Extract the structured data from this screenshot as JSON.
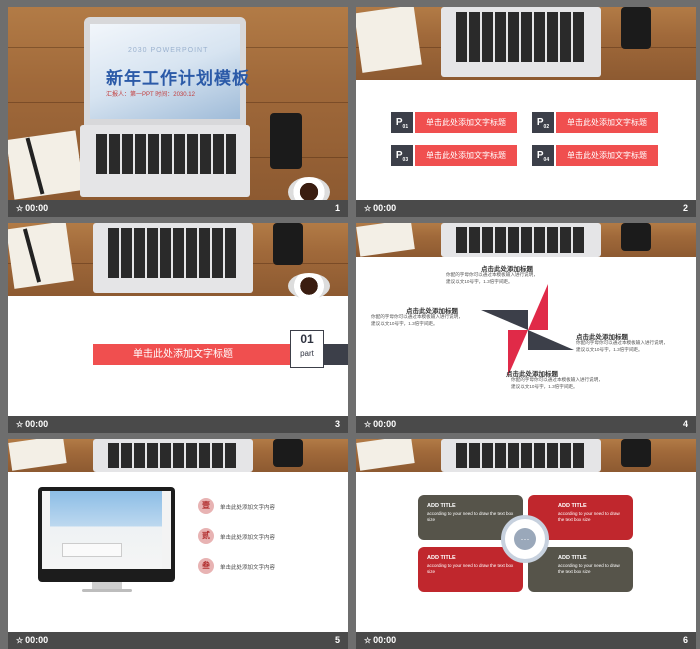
{
  "slides": [
    {
      "number": "1",
      "time": "00:00",
      "subtitle": "2030 POWERPOINT",
      "title": "新年工作计划模板",
      "info": "汇报人：第一PPT  时间：2030.12"
    },
    {
      "number": "2",
      "time": "00:00",
      "items": [
        {
          "icon": "P",
          "sub": "01",
          "label": "单击此处添加文字标题"
        },
        {
          "icon": "P",
          "sub": "02",
          "label": "单击此处添加文字标题"
        },
        {
          "icon": "P",
          "sub": "03",
          "label": "单击此处添加文字标题"
        },
        {
          "icon": "P",
          "sub": "04",
          "label": "单击此处添加文字标题"
        }
      ]
    },
    {
      "number": "3",
      "time": "00:00",
      "banner": "单击此处添加文字标题",
      "part_number": "01",
      "part_label": "part"
    },
    {
      "number": "4",
      "time": "00:00",
      "blocks": [
        {
          "title": "点击此处添加标题",
          "text": "你配的字母你可以通过本模板输入进行说明，建议以文10号字，1.3倍字间距。"
        },
        {
          "title": "点击此处添加标题",
          "text": "你配的字母你可以通过本模板输入进行说明，建议以文10号字，1.3倍字间距。"
        },
        {
          "title": "点击此处添加标题",
          "text": "你配的字母你可以通过本模板输入进行说明，建议以文10号字，1.3倍字间距。"
        },
        {
          "title": "点击此处添加标题",
          "text": "你配的字母你可以通过本模板输入进行说明，建议以文10号字，1.3倍字间距。"
        }
      ]
    },
    {
      "number": "5",
      "time": "00:00",
      "items": [
        {
          "icon": "壹",
          "text": "单击此处添加文字内容"
        },
        {
          "icon": "贰",
          "text": "单击此处添加文字内容"
        },
        {
          "icon": "叁",
          "text": "单击此处添加文字内容"
        }
      ]
    },
    {
      "number": "6",
      "time": "00:00",
      "boxes": [
        {
          "title": "ADD TITLE",
          "text": "according to your need to draw the text box size"
        },
        {
          "title": "ADD TITLE",
          "text": "according to your need to draw the text box size"
        },
        {
          "title": "ADD TITLE",
          "text": "according to your need to draw the text box size"
        },
        {
          "title": "ADD TITLE",
          "text": "according to your need to draw the text box size"
        }
      ],
      "center_icon": "chat-bubble-icon"
    }
  ],
  "colors": {
    "accent_red": "#f04f4f",
    "dark_slate": "#3c3f49",
    "deep_red": "#c0272d",
    "olive_gray": "#56544a",
    "title_blue": "#2b5aa8"
  }
}
